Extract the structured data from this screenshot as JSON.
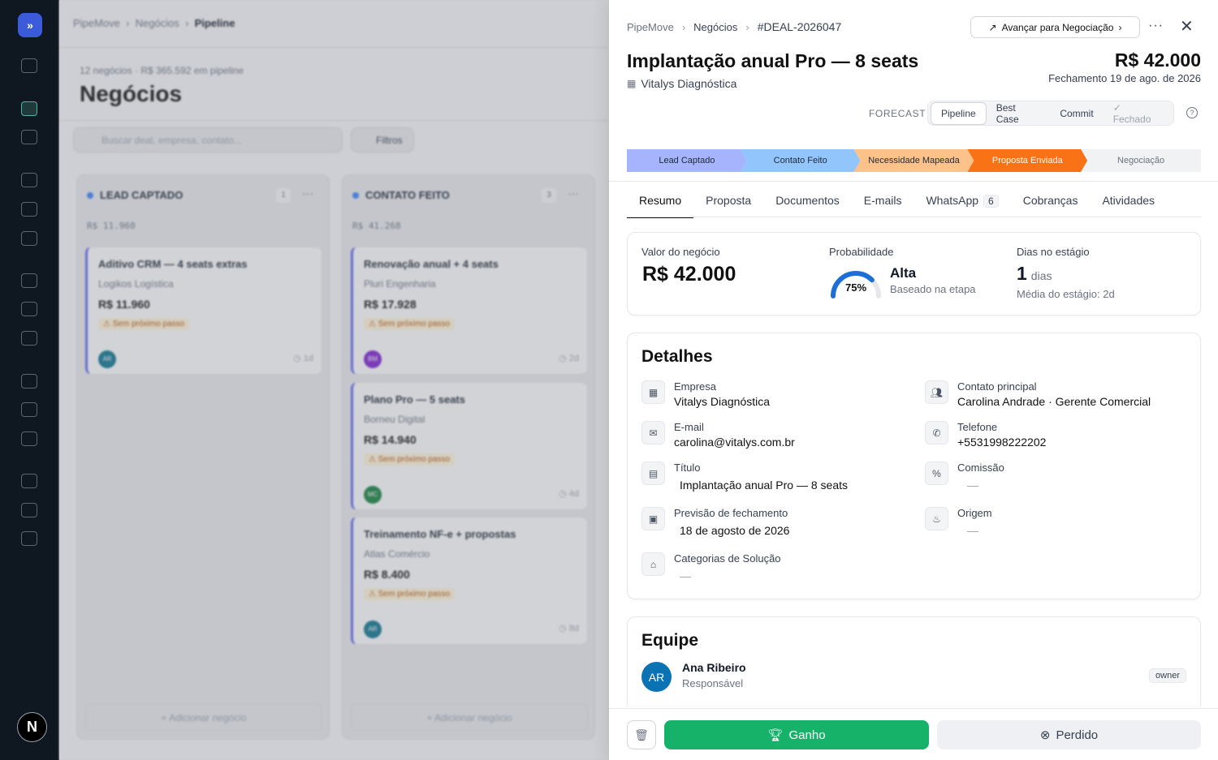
{
  "background": {
    "breadcrumb": {
      "root": "PipeMove",
      "section": "Negócios",
      "current": "Pipeline"
    },
    "summary": "12 negócios · R$ 365.592 em pipeline",
    "title": "Negócios",
    "search_placeholder": "Buscar deal, empresa, contato...",
    "filters_label": "Filtros",
    "add_deal_label": "+ Adicionar negócio",
    "columns": [
      {
        "name": "LEAD CAPTADO",
        "count": "1",
        "total": "R$ 11.960",
        "cards": [
          {
            "title": "Aditivo CRM — 4 seats extras",
            "company": "Logikos Logística",
            "value": "R$ 11.960",
            "warning": "⚠ Sem próximo passo",
            "avatar": "AR",
            "avatar_color": "#0e7490",
            "age": "◷ 1d"
          }
        ]
      },
      {
        "name": "CONTATO FEITO",
        "count": "3",
        "total": "R$ 41.268",
        "cards": [
          {
            "title": "Renovação anual + 4 seats",
            "company": "Pluri Engenharia",
            "value": "R$ 17.928",
            "warning": "⚠ Sem próximo passo",
            "avatar": "BM",
            "avatar_color": "#7e22ce",
            "age": "◷ 2d"
          },
          {
            "title": "Plano Pro — 5 seats",
            "company": "Borneu Digital",
            "value": "R$ 14.940",
            "warning": "⚠ Sem próximo passo",
            "avatar": "MC",
            "avatar_color": "#15803d",
            "age": "◷ 4d"
          },
          {
            "title": "Treinamento NF-e + propostas",
            "company": "Atlas Comércio",
            "value": "R$ 8.400",
            "warning": "⚠ Sem próximo passo",
            "avatar": "AR",
            "avatar_color": "#0e7490",
            "age": "◷ 8d"
          }
        ]
      }
    ]
  },
  "rail": {
    "user_initial": "N"
  },
  "panel": {
    "breadcrumb": {
      "root": "PipeMove",
      "section": "Negócios",
      "deal_id": "#DEAL-2026047"
    },
    "advance_label": "Avançar para Negociação",
    "title": "Implantação anual Pro — 8 seats",
    "company": "Vitalys Diagnóstica",
    "amount": "R$ 42.000",
    "closing": "Fechamento 19 de ago. de 2026",
    "forecast_label": "FORECAST",
    "forecast_options": [
      "Pipeline",
      "Best Case",
      "Commit",
      "✓ Fechado"
    ],
    "forecast_selected": "Pipeline",
    "stages": [
      {
        "label": "Lead Captado",
        "bg": "#a5b4fc",
        "fg": "#1f2937"
      },
      {
        "label": "Contato Feito",
        "bg": "#93c5fd",
        "fg": "#1f2937"
      },
      {
        "label": "Necessidade Mapeada",
        "bg": "#fdc28a",
        "fg": "#1f2937"
      },
      {
        "label": "Proposta Enviada",
        "bg": "#f97316",
        "fg": "#ffffff"
      },
      {
        "label": "Negociação",
        "bg": "#f1f2f4",
        "fg": "#6b7280"
      }
    ],
    "tabs": [
      "Resumo",
      "Proposta",
      "Documentos",
      "E-mails",
      "WhatsApp",
      "Cobranças",
      "Atividades"
    ],
    "whatsapp_count": "6",
    "metrics": {
      "value_label": "Valor do negócio",
      "value": "R$ 42.000",
      "prob_label": "Probabilidade",
      "prob_percent": 75,
      "prob_text": "75%",
      "prob_level": "Alta",
      "prob_basis": "Baseado na etapa",
      "days_label": "Dias no estágio",
      "days": "1",
      "days_unit": "dias",
      "days_avg": "Média do estágio: 2d"
    },
    "details": {
      "heading": "Detalhes",
      "empresa_label": "Empresa",
      "empresa": "Vitalys Diagnóstica",
      "contato_label": "Contato principal",
      "contato": "Carolina Andrade · Gerente Comercial",
      "email_label": "E-mail",
      "email": "carolina@vitalys.com.br",
      "telefone_label": "Telefone",
      "telefone": "+5531998222202",
      "titulo_label": "Título",
      "titulo": "Implantação anual Pro — 8 seats",
      "comissao_label": "Comissão",
      "comissao": "—",
      "previsao_label": "Previsão de fechamento",
      "previsao": "18 de agosto de 2026",
      "origem_label": "Origem",
      "origem": "—",
      "categorias_label": "Categorias de Solução",
      "categorias": "—"
    },
    "team": {
      "heading": "Equipe",
      "member_initials": "AR",
      "member_name": "Ana Ribeiro",
      "member_role": "Responsável",
      "member_badge": "owner"
    },
    "won_label": "Ganho",
    "lost_label": "Perdido"
  }
}
